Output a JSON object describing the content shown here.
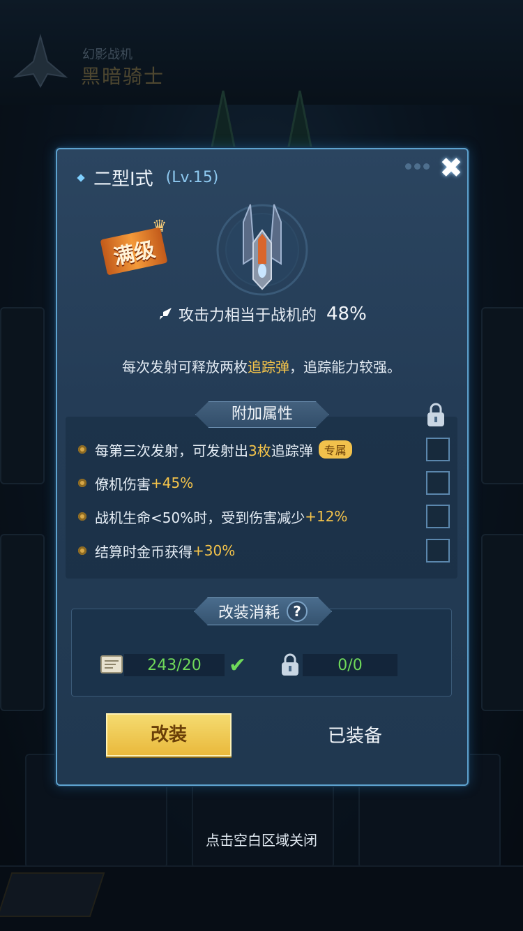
{
  "background": {
    "ship_type": "幻影战机",
    "ship_name": "黑暗骑士"
  },
  "dialog": {
    "weapon_name": "二型I式",
    "level": "(Lv.15)",
    "max_badge": "满级",
    "attack_text": "攻击力相当于战机的",
    "attack_percent": "48%",
    "description": {
      "before": "每次发射可释放两枚",
      "highlight": "追踪弹",
      "after": "，追踪能力较强。"
    },
    "attributes_title": "附加属性",
    "attributes": [
      {
        "text": "每第三次发射，可发射出",
        "value": "3枚",
        "suffix": "追踪弹",
        "tag": "专属"
      },
      {
        "text": "僚机伤害",
        "value": "+45%"
      },
      {
        "text": "战机生命<50%时，受到伤害减少",
        "value": "+12%"
      },
      {
        "text": "结算时金币获得",
        "value": "+30%"
      }
    ],
    "cost_title": "改装消耗",
    "cost_help": "?",
    "costs": [
      {
        "icon": "blueprint-icon",
        "have": "243",
        "need": "/20"
      },
      {
        "icon": "lock-icon",
        "have": "0",
        "need": "/0"
      }
    ],
    "modify_button": "改装",
    "equipped_label": "已装备",
    "close_symbol": "✖"
  },
  "close_hint": "点击空白区域关闭",
  "colors": {
    "accent_gold": "#f5c44a",
    "accent_green": "#6fd95a",
    "dialog_border": "#5ea3d0"
  }
}
